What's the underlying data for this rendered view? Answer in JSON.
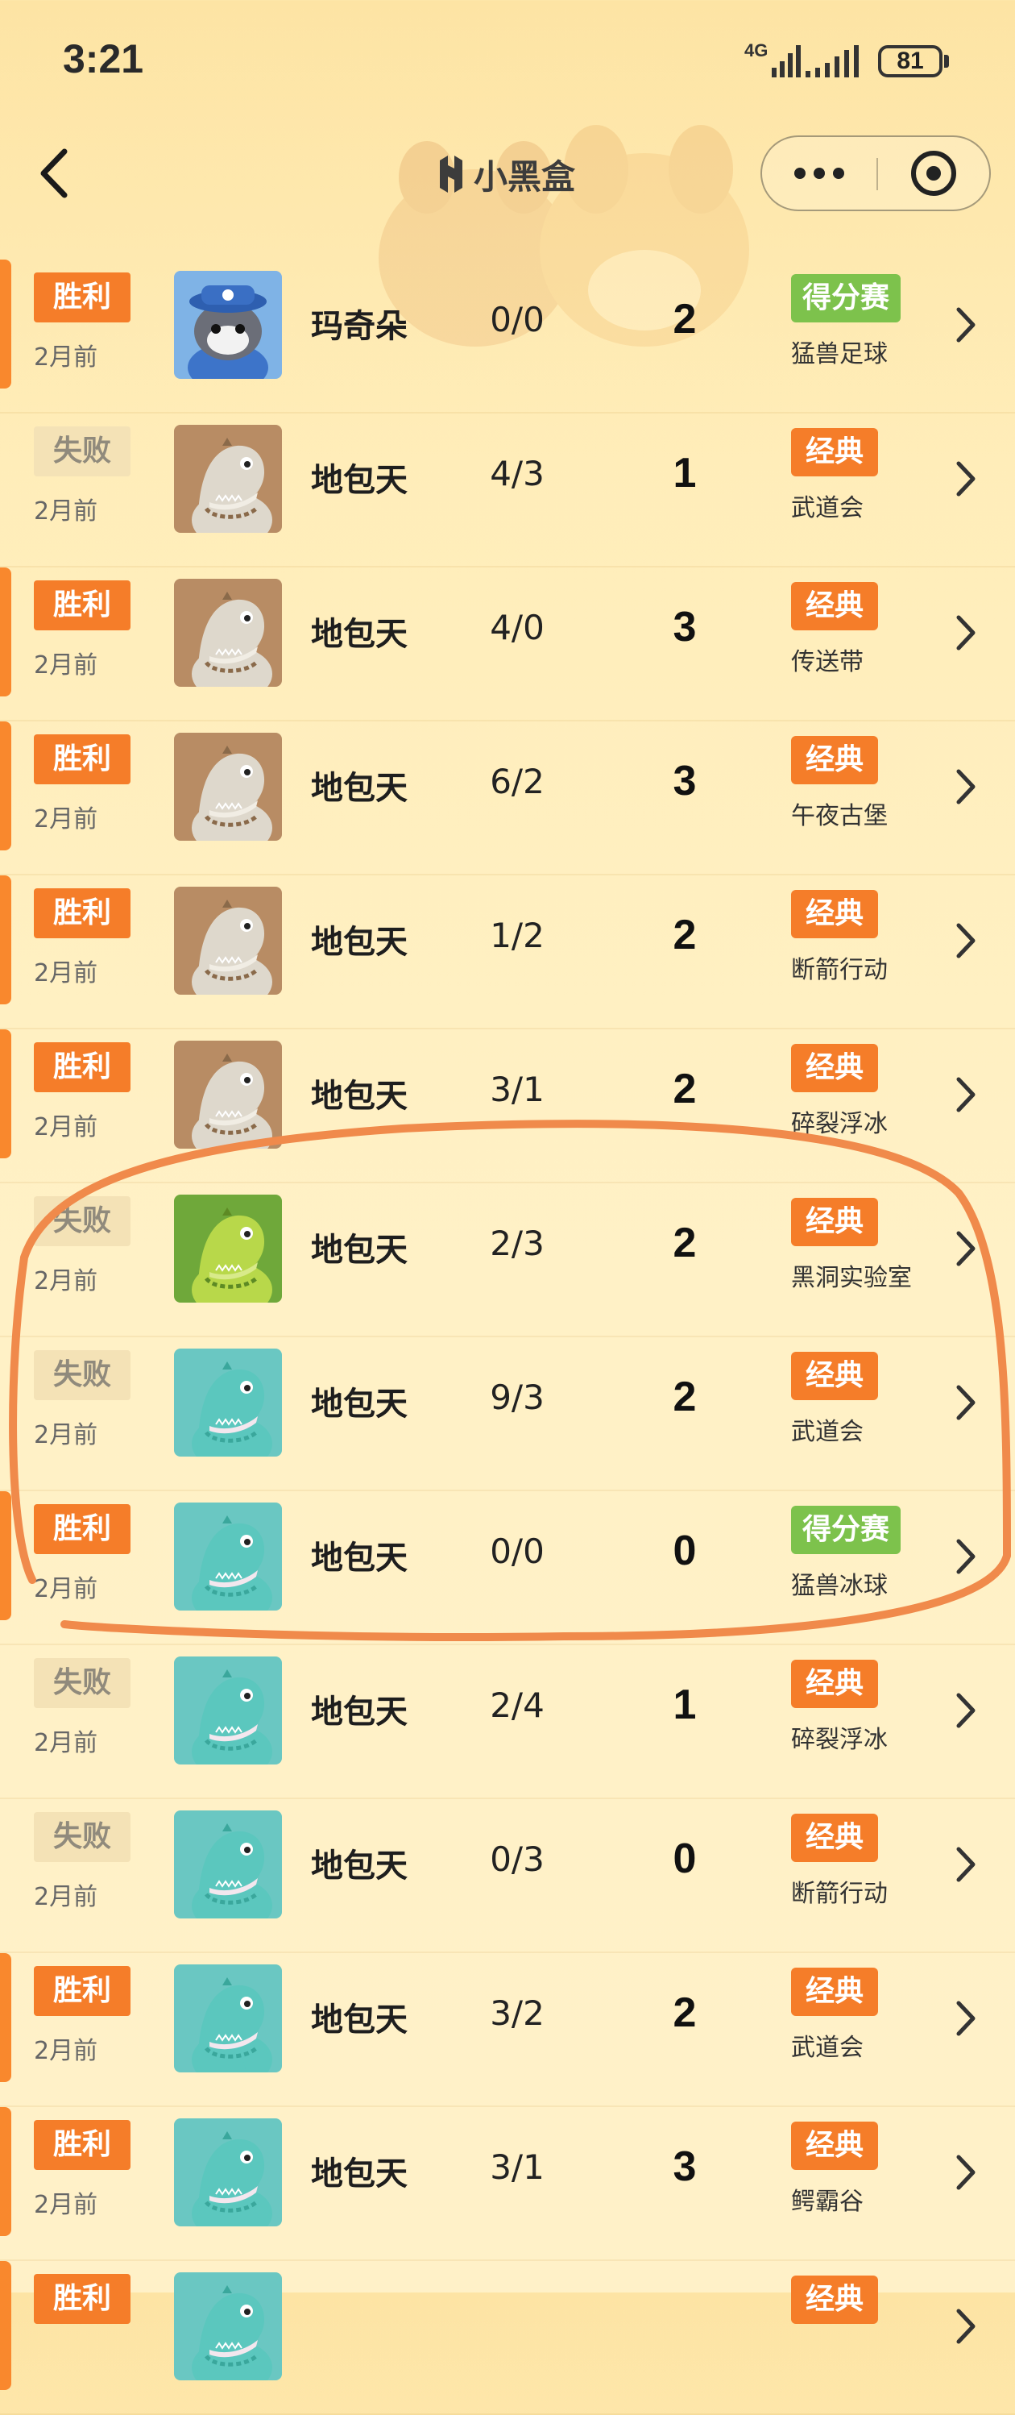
{
  "status_bar": {
    "time": "3:21",
    "network": "4G",
    "battery": "81"
  },
  "header": {
    "app_name": "小黑盒"
  },
  "icons": {
    "back": "chevron-left-icon",
    "more": "more-dots-icon",
    "close": "target-close-icon",
    "brand": "xiaoheihe-logo-icon",
    "row_arrow": "chevron-right-icon"
  },
  "colors": {
    "win": "#f57d29",
    "lose_badge": "#f4e2b6",
    "scoring_mode": "#7dc24c",
    "annotation": "#f08a4b"
  },
  "matches": [
    {
      "result": "胜利",
      "win": true,
      "time": "2月前",
      "avatar": "cat",
      "name": "玛奇朵",
      "kd": "0/0",
      "score": "2",
      "mode": "得分赛",
      "mode_type": "scoring",
      "map": "猛兽足球"
    },
    {
      "result": "失败",
      "win": false,
      "time": "2月前",
      "avatar": "dino-beige",
      "name": "地包天",
      "kd": "4/3",
      "score": "1",
      "mode": "经典",
      "mode_type": "classic",
      "map": "武道会"
    },
    {
      "result": "胜利",
      "win": true,
      "time": "2月前",
      "avatar": "dino-beige",
      "name": "地包天",
      "kd": "4/0",
      "score": "3",
      "mode": "经典",
      "mode_type": "classic",
      "map": "传送带"
    },
    {
      "result": "胜利",
      "win": true,
      "time": "2月前",
      "avatar": "dino-beige",
      "name": "地包天",
      "kd": "6/2",
      "score": "3",
      "mode": "经典",
      "mode_type": "classic",
      "map": "午夜古堡"
    },
    {
      "result": "胜利",
      "win": true,
      "time": "2月前",
      "avatar": "dino-beige",
      "name": "地包天",
      "kd": "1/2",
      "score": "2",
      "mode": "经典",
      "mode_type": "classic",
      "map": "断箭行动"
    },
    {
      "result": "胜利",
      "win": true,
      "time": "2月前",
      "avatar": "dino-beige",
      "name": "地包天",
      "kd": "3/1",
      "score": "2",
      "mode": "经典",
      "mode_type": "classic",
      "map": "碎裂浮冰"
    },
    {
      "result": "失败",
      "win": false,
      "time": "2月前",
      "avatar": "dino-green",
      "name": "地包天",
      "kd": "2/3",
      "score": "2",
      "mode": "经典",
      "mode_type": "classic",
      "map": "黑洞实验室"
    },
    {
      "result": "失败",
      "win": false,
      "time": "2月前",
      "avatar": "dino-teal",
      "name": "地包天",
      "kd": "9/3",
      "score": "2",
      "mode": "经典",
      "mode_type": "classic",
      "map": "武道会"
    },
    {
      "result": "胜利",
      "win": true,
      "time": "2月前",
      "avatar": "dino-teal",
      "name": "地包天",
      "kd": "0/0",
      "score": "0",
      "mode": "得分赛",
      "mode_type": "scoring",
      "map": "猛兽冰球"
    },
    {
      "result": "失败",
      "win": false,
      "time": "2月前",
      "avatar": "dino-teal",
      "name": "地包天",
      "kd": "2/4",
      "score": "1",
      "mode": "经典",
      "mode_type": "classic",
      "map": "碎裂浮冰"
    },
    {
      "result": "失败",
      "win": false,
      "time": "2月前",
      "avatar": "dino-teal",
      "name": "地包天",
      "kd": "0/3",
      "score": "0",
      "mode": "经典",
      "mode_type": "classic",
      "map": "断箭行动"
    },
    {
      "result": "胜利",
      "win": true,
      "time": "2月前",
      "avatar": "dino-teal",
      "name": "地包天",
      "kd": "3/2",
      "score": "2",
      "mode": "经典",
      "mode_type": "classic",
      "map": "武道会"
    },
    {
      "result": "胜利",
      "win": true,
      "time": "2月前",
      "avatar": "dino-teal",
      "name": "地包天",
      "kd": "3/1",
      "score": "3",
      "mode": "经典",
      "mode_type": "classic",
      "map": "鳄霸谷"
    },
    {
      "result": "胜利",
      "win": true,
      "time": "",
      "avatar": "dino-teal",
      "name": "",
      "kd": "",
      "score": "",
      "mode": "经典",
      "mode_type": "classic",
      "map": ""
    }
  ]
}
